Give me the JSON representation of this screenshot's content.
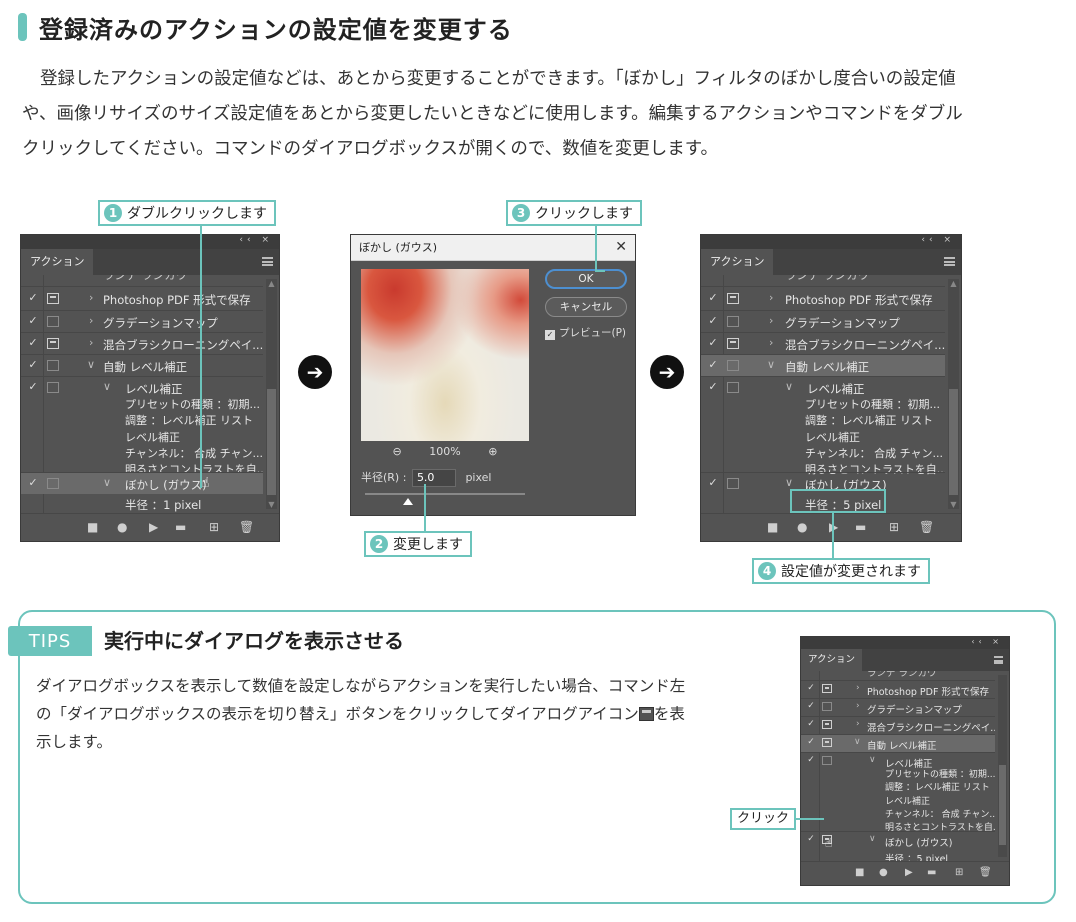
{
  "heading": "登録済みのアクションの設定値を変更する",
  "intro": [
    "登録したアクションの設定値などは、あとから変更することができます。「ぼかし」フィルタのぼかし度合いの設定値",
    "や、画像リサイズのサイズ設定値をあとから変更したいときなどに使用します。編集するアクションやコマンドをダブル",
    "クリックしてください。コマンドのダイアログボックスが開くので、数値を変更します。"
  ],
  "callouts": {
    "c1": {
      "num": "1",
      "text": "ダブルクリックします"
    },
    "c2": {
      "num": "2",
      "text": "変更します"
    },
    "c3": {
      "num": "3",
      "text": "クリックします"
    },
    "c4": {
      "num": "4",
      "text": "設定値が変更されます"
    }
  },
  "panel": {
    "controls": "‹‹ ×",
    "tab": "アクション",
    "rows": {
      "cut": "ランデ ランカウ",
      "pdf": "Photoshop PDF 形式で保存",
      "gradient": "グラデーションマップ",
      "brush": "混合ブラシクローニングペイ...",
      "auto": "自動 レベル補正",
      "level": "レベル補正",
      "preset": "プリセットの種類 ：初期...",
      "adjust": "調整 ：レベル補正 リスト",
      "level2": "レベル補正",
      "channel": "チャンネル： 合成 チャン...",
      "bright": "明るさとコントラストを自...",
      "blur": "ぼかし (ガウス)",
      "radius_before": "半径 ：1 pixel",
      "radius_after": "半径 ：5 pixel"
    },
    "check": "✓",
    "expand": "›",
    "collapse": "∨"
  },
  "dialog": {
    "title": "ぼかし (ガウス)",
    "close": "✕",
    "ok": "OK",
    "cancel": "キャンセル",
    "preview": "プレビュー(P)",
    "zoom_out": "⊖",
    "zoom": "100%",
    "zoom_in": "⊕",
    "radius_label": "半径(R) :",
    "radius_value": "5.0",
    "unit": "pixel"
  },
  "arrow": "➔",
  "tips": {
    "badge": "TIPS",
    "title": "実行中にダイアログを表示させる",
    "text1": "ダイアログボックスを表示して数値を設定しながらアクションを実行したい場合、コマンド左",
    "text2a": "の「ダイアログボックスの表示を切り替え」ボタンをクリックしてダイアログアイコン",
    "text2b": "を表",
    "text3": "示します。",
    "click": "クリック"
  }
}
